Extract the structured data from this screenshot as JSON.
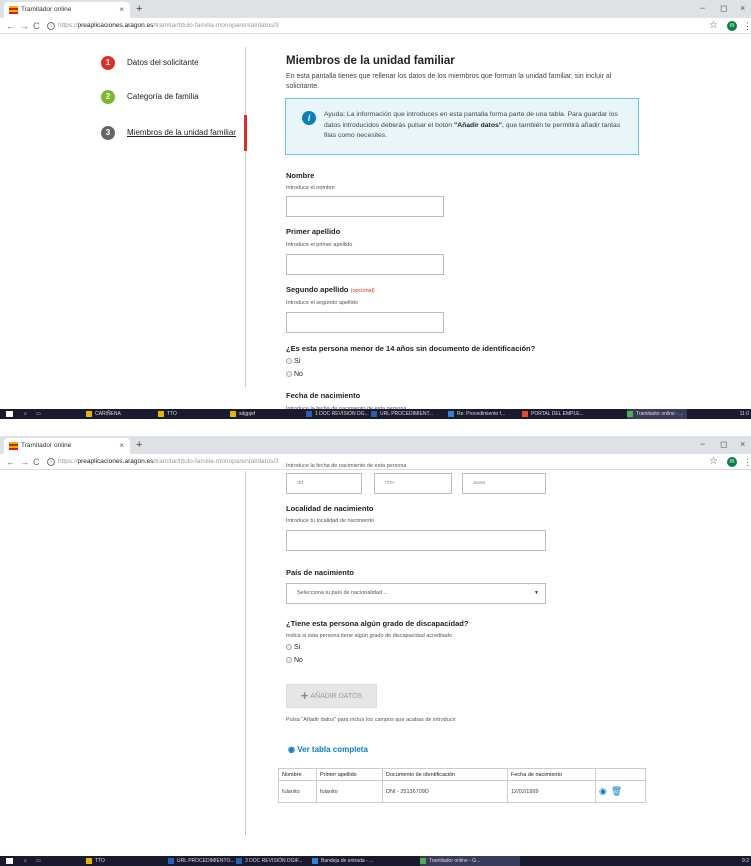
{
  "browser": {
    "tab_title": "Tramitador online",
    "tab_close": "×",
    "new_tab": "+",
    "url_prefix": "https://",
    "url_domain": "preaplicaciones.aragon.es",
    "url_path": "/tramitar/titulo-familia-monoparental/datos/3",
    "avatar_letter": "m",
    "minimize": "−",
    "maximize": "◻",
    "close": "×"
  },
  "taskbar1": {
    "items": [
      "CARIÑENA",
      "TTO",
      "sdgpjef",
      "1 DOC REVISIÓN DG...",
      "URL PROCEDIMIENT...",
      "Re: Procedimiento f...",
      "PORTAL DEL EMPLE...",
      "Tramitador online - ..."
    ],
    "clock": "11:0"
  },
  "taskbar2": {
    "items": [
      "TTO",
      "URL PROCEDIMIENTO...",
      "3 DOC REVISIÓN DGIF...",
      "Bandeja de entrada - ...",
      "Tramitador online - G..."
    ],
    "clock": "9:2"
  },
  "steps": [
    {
      "num": "1",
      "label": "Datos del solicitante",
      "color": "#d9302c"
    },
    {
      "num": "2",
      "label": "Categoría de familia",
      "color": "#7ab929"
    },
    {
      "num": "3",
      "label": "Miembros de la unidad familiar",
      "color": "#666666"
    }
  ],
  "page": {
    "title": "Miembros de la unidad familiar",
    "intro": "En esta pantalla tienes que rellenar los datos de los miembros que forman la unidad familiar, sin incluir al solicitante.",
    "info_icon": "i",
    "info_pre": "Ayuda: La información que introduces en esta pantalla forma parte de una tabla. Para guardar los datos introducidos deberás pulsar el botón ",
    "info_bold": "\"Añadir datos\"",
    "info_post": ", que también te permitirá añadir tantas filas como necesites."
  },
  "fields": {
    "nombre_label": "Nombre",
    "nombre_help": "Introduce el nombre",
    "apellido1_label": "Primer apellido",
    "apellido1_help": "Introduce el primer apellido",
    "apellido2_label": "Segundo apellido",
    "apellido2_optional": "(opcional)",
    "apellido2_help": "Introduce el segundo apellido",
    "menor_label": "¿Es esta persona menor de 14 años sin documento de identificación?",
    "menor_si": "Si",
    "menor_no": "No",
    "fecha_label": "Fecha de nacimiento",
    "fecha_help": "Introduce la fecha de nacimiento de esta persona",
    "fecha_dd": "dd",
    "fecha_mm": "mm",
    "fecha_aaaa": "aaaa",
    "localidad_label": "Localidad de nacimiento",
    "localidad_help": "Introduce tu localidad de nacimiento",
    "pais_label": "País de nacimiento",
    "pais_placeholder": "Selecciona tu país de nacionalidad ...",
    "disc_label": "¿Tiene esta persona algún grado de discapacidad?",
    "disc_help": "Indica si esta persona tiene algún grado de discapacidad acreditado",
    "disc_si": "Si",
    "disc_no": "No"
  },
  "actions": {
    "add_label": "AÑADIR DATOS",
    "add_hint": "Pulsa \"Añadir datos\" para incluir los campos que acabas de introducir",
    "view_table": "Ver tabla completa"
  },
  "table": {
    "headers": [
      "Nombre",
      "Primer apellido",
      "Documento de identificación",
      "Fecha de nacimiento"
    ],
    "rows": [
      {
        "nombre": "fulanito",
        "apellido": "fulanito",
        "documento": "DNI - 25136709D",
        "fecha": "12/02/1999"
      }
    ]
  }
}
